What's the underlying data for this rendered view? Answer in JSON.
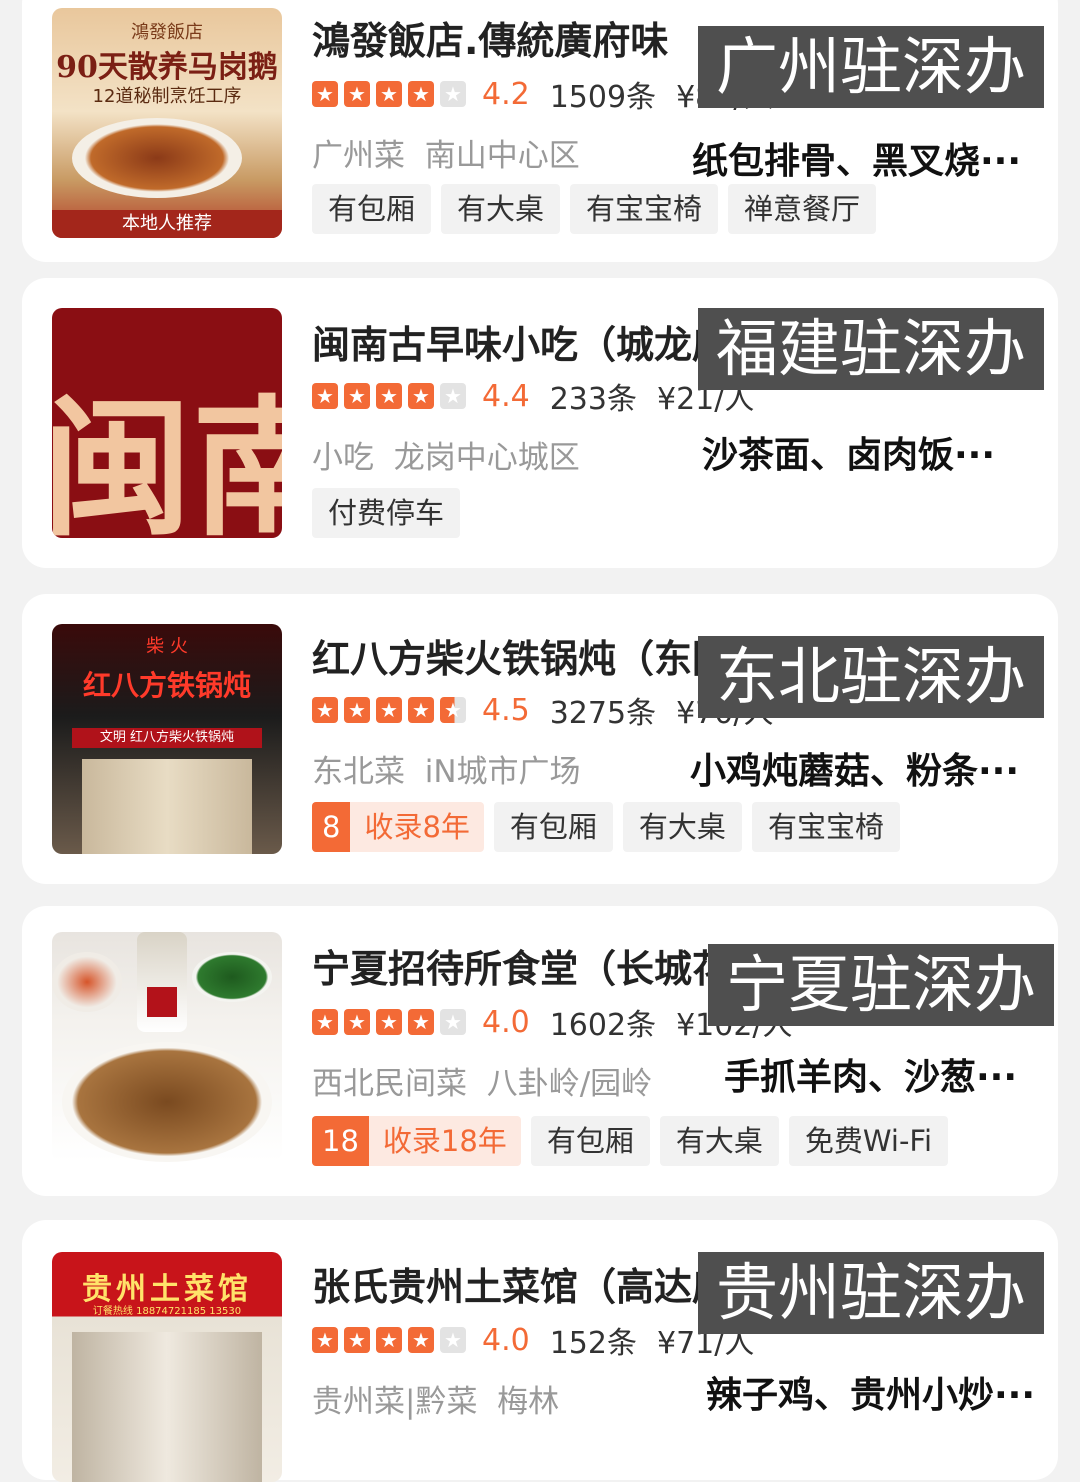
{
  "restaurants": [
    {
      "name": "鴻發飯店.傳統廣府味",
      "score": "4.2",
      "reviews": "1509条",
      "price": "¥88/人",
      "cuisine": "广州菜",
      "area": "南山中心区",
      "tags": [
        "有包厢",
        "有大桌",
        "有宝宝椅",
        "禅意餐厅"
      ],
      "overlay": "广州驻深办",
      "dishes": "纸包排骨、黑叉烧···",
      "thumb": {
        "brand": "鴻發飯店",
        "headline": "90天散养马岗鹅",
        "sub": "12道秘制烹饪工序",
        "footer": "本地人推荐"
      }
    },
    {
      "name": "闽南古早味小吃（城龙店）",
      "score": "4.4",
      "reviews": "233条",
      "price": "¥21/人",
      "cuisine": "小吃",
      "area": "龙岗中心城区",
      "tags": [
        "付费停车"
      ],
      "overlay": "福建驻深办",
      "dishes": "沙茶面、卤肉饭···",
      "thumb": {
        "text": "闽南"
      }
    },
    {
      "name": "红八方柴火铁锅炖（东园路店）",
      "score": "4.5",
      "reviews": "3275条",
      "price": "¥70/人",
      "cuisine": "东北菜",
      "area": "iN城市广场",
      "recorded": {
        "num": "8",
        "label": "收录8年"
      },
      "tags": [
        "有包厢",
        "有大桌",
        "有宝宝椅"
      ],
      "overlay": "东北驻深办",
      "dishes": "小鸡炖蘑菇、粉条···",
      "thumb": {
        "small": "柴 火",
        "sign": "红八方铁锅炖",
        "banner": "文明 红八方柴火铁锅炖"
      }
    },
    {
      "name": "宁夏招待所食堂（长城花园店）",
      "score": "4.0",
      "reviews": "1602条",
      "price": "¥102/人",
      "cuisine": "西北民间菜",
      "area": "八卦岭/园岭",
      "recorded": {
        "num": "18",
        "label": "收录18年"
      },
      "tags": [
        "有包厢",
        "有大桌",
        "免费Wi-Fi"
      ],
      "overlay": "宁夏驻深办",
      "dishes": "手抓羊肉、沙葱···"
    },
    {
      "name": "张氏贵州土菜馆（高达店）",
      "score": "4.0",
      "reviews": "152条",
      "price": "¥71/人",
      "cuisine": "贵州菜|黔菜",
      "area": "梅林",
      "tags": [],
      "overlay": "贵州驻深办",
      "dishes": "辣子鸡、贵州小炒···",
      "thumb": {
        "sign": "贵州土菜馆",
        "phone": "订餐热线 18874721185 13530"
      }
    }
  ],
  "ratings": [
    4.2,
    4.4,
    4.5,
    4.0,
    4.0
  ],
  "colors": {
    "accent": "#f36a36",
    "overlay_bg": "#4f4f4f",
    "page_bg": "#f2f2f2"
  },
  "icons": {
    "star": "star-icon"
  }
}
